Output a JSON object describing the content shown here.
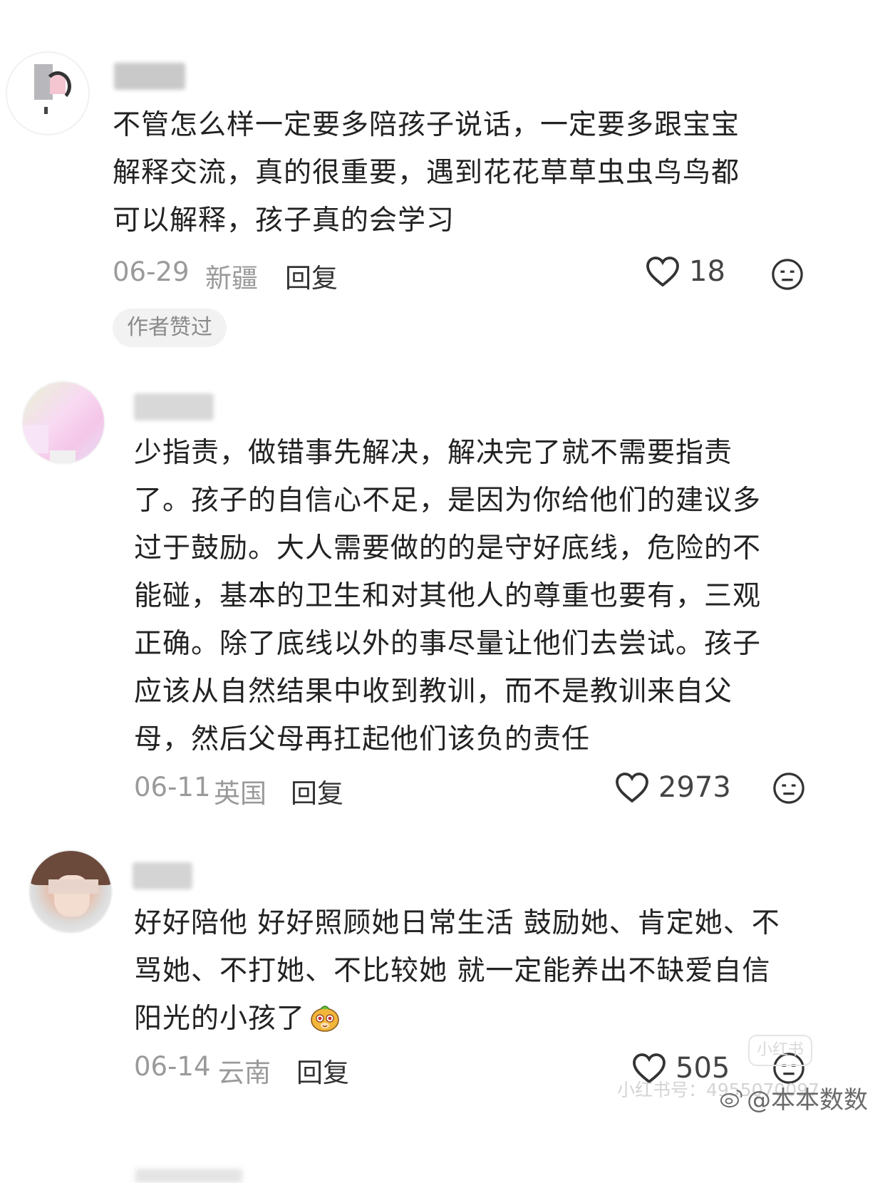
{
  "comments": [
    {
      "text": "不管怎么样一定要多陪孩子说话，一定要多跟宝宝\n解释交流，真的很重要，遇到花花草草虫虫鸟鸟都\n可以解释，孩子真的会学习",
      "date": "06-29",
      "location": "新疆",
      "reply_label": "回复",
      "likes": "18",
      "badge": "作者赞过"
    },
    {
      "text": "少指责，做错事先解决，解决完了就不需要指责\n了。孩子的自信心不足，是因为你给他们的建议多\n过于鼓励。大人需要做的的是守好底线，危险的不\n能碰，基本的卫生和对其他人的尊重也要有，三观\n正确。除了底线以外的事尽量让他们去尝试。孩子\n应该从自然结果中收到教训，而不是教训来自父\n母，然后父母再扛起他们该负的责任",
      "date": "06-11",
      "location": "英国",
      "reply_label": "回复",
      "likes": "2973"
    },
    {
      "text": "好好陪他 好好照顾她日常生活 鼓励她、肯定她、不\n骂她、不打她、不比较她 就一定能养出不缺爱自信\n阳光的小孩了",
      "date": "06-14",
      "location": "云南",
      "reply_label": "回复",
      "likes": "505"
    }
  ],
  "watermark": {
    "logo_text": "小红书",
    "id_text": "小红书号：4955070097",
    "weibo_text": "@本本数数"
  }
}
